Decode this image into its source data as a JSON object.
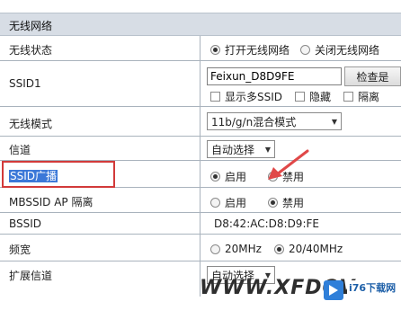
{
  "section_title": "无线网络",
  "rows": {
    "wireless_status": {
      "label": "无线状态",
      "opt_on": "打开无线网络",
      "opt_off": "关闭无线网络"
    },
    "ssid1": {
      "label": "SSID1",
      "value": "Feixun_D8D9FE",
      "button": "检查是",
      "opt_multi": "显示多SSID",
      "opt_hide": "隐藏",
      "opt_isolate": "隔离"
    },
    "wireless_mode": {
      "label": "无线模式",
      "selected": "11b/g/n混合模式"
    },
    "channel": {
      "label": "信道",
      "selected": "自动选择"
    },
    "ssid_broadcast": {
      "label": "SSID广播",
      "opt_enable": "启用",
      "opt_disable": "禁用"
    },
    "mbssid_isolation": {
      "label": "MBSSID AP 隔离",
      "opt_enable": "启用",
      "opt_disable": "禁用"
    },
    "bssid": {
      "label": "BSSID",
      "value": "D8:42:AC:D8:D9:FE"
    },
    "bandwidth": {
      "label": "频宽",
      "opt_20": "20MHz",
      "opt_2040": "20/40MHz"
    },
    "ext_channel": {
      "label": "扩展信道",
      "selected": "自动选择"
    }
  },
  "watermark": {
    "text": "WWW.XFDOV",
    "site": "i76下载网",
    "domain": ""
  },
  "colors": {
    "header_bg": "#d7dde5",
    "highlight_border": "#d23a3a",
    "selection": "#3b78d8",
    "arrow": "#e04848"
  }
}
